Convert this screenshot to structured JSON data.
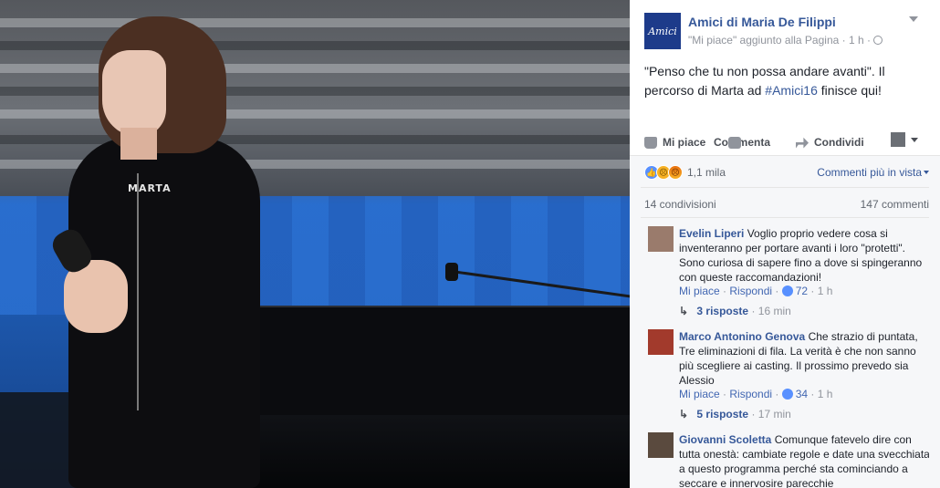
{
  "page": {
    "name": "Amici di Maria De Filippi",
    "avatar_text": "Amici",
    "meta": "\"Mi piace\" aggiunto alla Pagina · 1 h ·"
  },
  "post": {
    "text_before": "\"Penso che tu non possa andare avanti\". Il percorso di Marta ad ",
    "hashtag": "#Amici16",
    "text_after": " finisce qui!",
    "shirt_print": "MARTA"
  },
  "actions": {
    "like": "Mi piace",
    "comment": "Commenta",
    "share": "Condividi"
  },
  "reactions": {
    "count": "1,1 mila",
    "types": [
      "like",
      "sad",
      "angry"
    ],
    "sort_label": "Commenti più in vista"
  },
  "stats": {
    "shares": "14 condivisioni",
    "comments": "147 commenti"
  },
  "comments": [
    {
      "author": "Evelin Liperi",
      "text": "Voglio proprio vedere cosa si inventeranno per portare avanti i loro \"protetti\". Sono curiosa di sapere fino a dove si spingeranno con queste raccomandazioni!",
      "like_label": "Mi piace",
      "reply_label": "Rispondi",
      "likes": "72",
      "time": "1 h",
      "replies": "3 risposte",
      "replies_time": "16 min"
    },
    {
      "author": "Marco Antonino Genova",
      "text": "Che strazio di puntata, Tre eliminazioni di fila. La verità è che non sanno più scegliere ai casting. Il prossimo prevedo sia Alessio",
      "like_label": "Mi piace",
      "reply_label": "Rispondi",
      "likes": "34",
      "time": "1 h",
      "replies": "5 risposte",
      "replies_time": "17 min"
    },
    {
      "author": "Giovanni Scoletta",
      "text": "Comunque fatevelo dire con tutta onestà: cambiate regole e date una svecchiata a questo programma perché sta cominciando a seccare e innervosire parecchie"
    }
  ],
  "colors": {
    "link": "#365899",
    "like_blue": "#5890ff",
    "page_avatar": "#1d3b8a"
  }
}
